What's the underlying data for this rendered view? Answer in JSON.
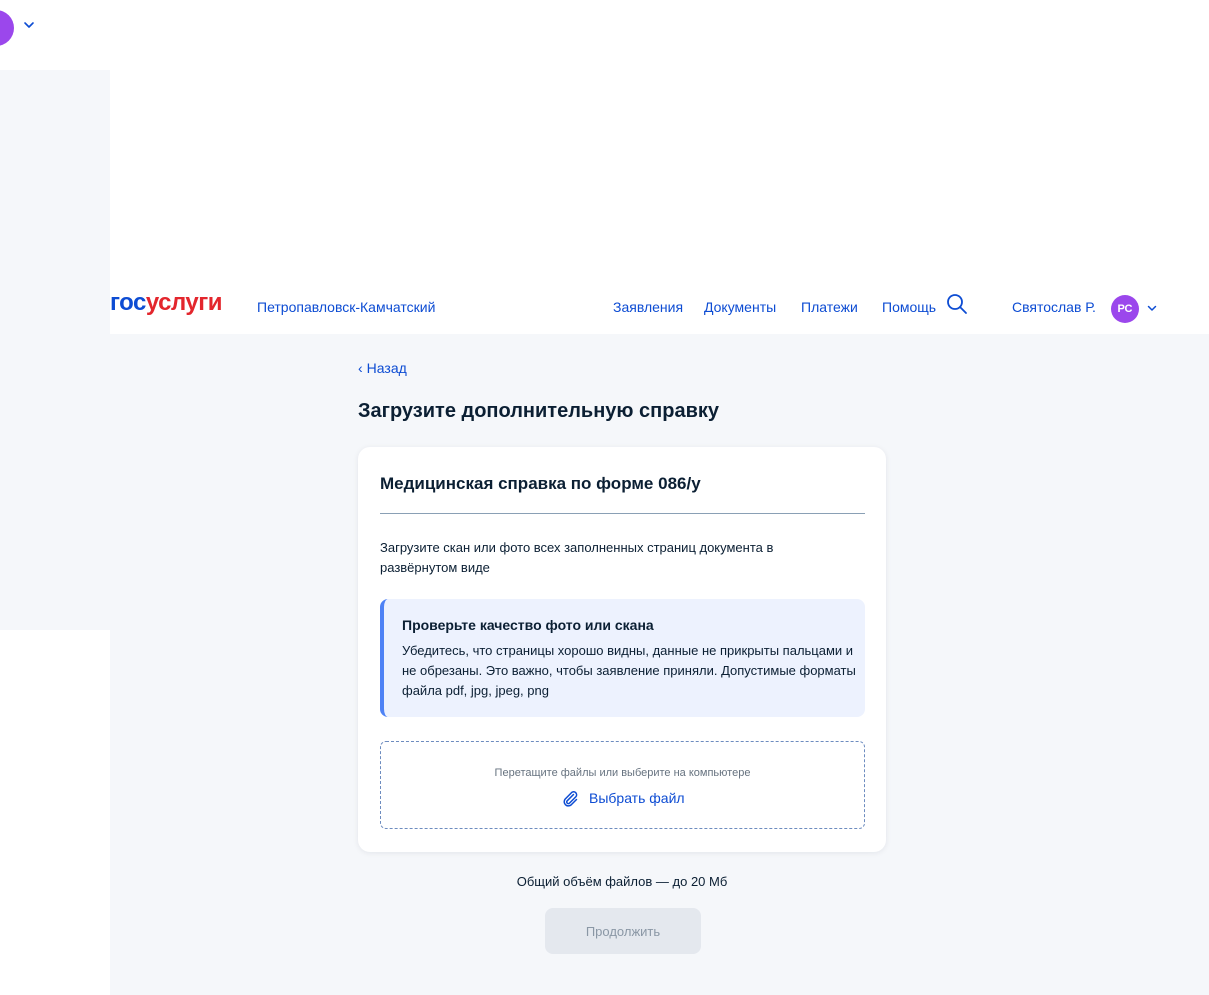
{
  "brand": {
    "part1": "гос",
    "part2": "услуги"
  },
  "header": {
    "city": "Петропавловск-Камчатский",
    "nav": [
      "Заявления",
      "Документы",
      "Платежи",
      "Помощь"
    ],
    "user_name": "Святослав Р.",
    "user_initials": "РС"
  },
  "page": {
    "back_label": "Назад",
    "title": "Загрузите дополнительную справку"
  },
  "card": {
    "title": "Медицинская справка по форме 086/у",
    "description": "Загрузите скан или фото всех заполненных страниц документа в развёрнутом виде",
    "notice_title": "Проверьте качество фото или скана",
    "notice_text": "Убедитесь, что страницы хорошо видны, данные не прикрыты пальцами и не обрезаны. Это важно, чтобы заявление приняли. Допустимые форматы файла pdf, jpg, jpeg, png",
    "drop_hint": "Перетащите файлы или выберите на компьютере",
    "choose_file_label": "Выбрать файл"
  },
  "footer": {
    "total_size": "Общий объём файлов — до 20 Мб",
    "continue_label": "Продолжить"
  },
  "colors": {
    "link": "#0d4cd3",
    "brand_red": "#e3262d",
    "avatar": "#9b47ec",
    "notice_bg": "#edf2fe",
    "notice_accent": "#4e82f5",
    "disabled_button": "#e4e8ee"
  },
  "icons": [
    "search-icon",
    "chevron-down-icon",
    "chevron-left-icon",
    "paperclip-icon"
  ]
}
